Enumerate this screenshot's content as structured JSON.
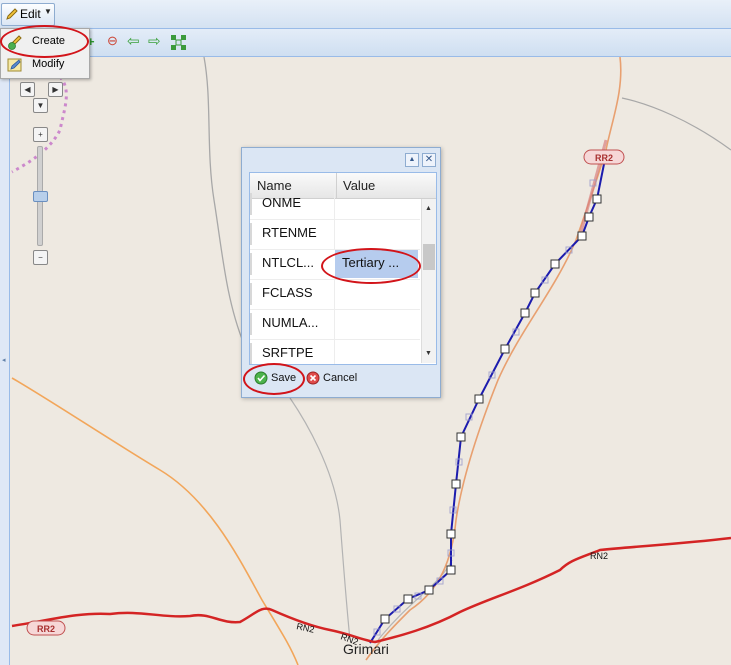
{
  "toolbar": {
    "edit_label": "Edit"
  },
  "edit_menu": {
    "items": [
      {
        "label": "Create",
        "icon": "pencil-plus-icon"
      },
      {
        "label": "Modify",
        "icon": "pencil-edit-icon"
      }
    ]
  },
  "map": {
    "place_label": "Grimari",
    "road_labels": [
      "RN2",
      "RN2",
      "RN2",
      "RR2",
      "RR2"
    ]
  },
  "attributes": {
    "columns": [
      "Name",
      "Value"
    ],
    "rows": [
      {
        "name": "ONME",
        "value": ""
      },
      {
        "name": "RTENME",
        "value": ""
      },
      {
        "name": "NTLCL...",
        "value": "Tertiary ..."
      },
      {
        "name": "FCLASS",
        "value": ""
      },
      {
        "name": "NUMLA...",
        "value": ""
      },
      {
        "name": "SRFTPE",
        "value": ""
      }
    ],
    "save_label": "Save",
    "cancel_label": "Cancel"
  },
  "colors": {
    "road_red": "#d42424",
    "route_blue": "#1c1cae",
    "highlight": "#b6ccee",
    "annotation": "#d2141a"
  }
}
